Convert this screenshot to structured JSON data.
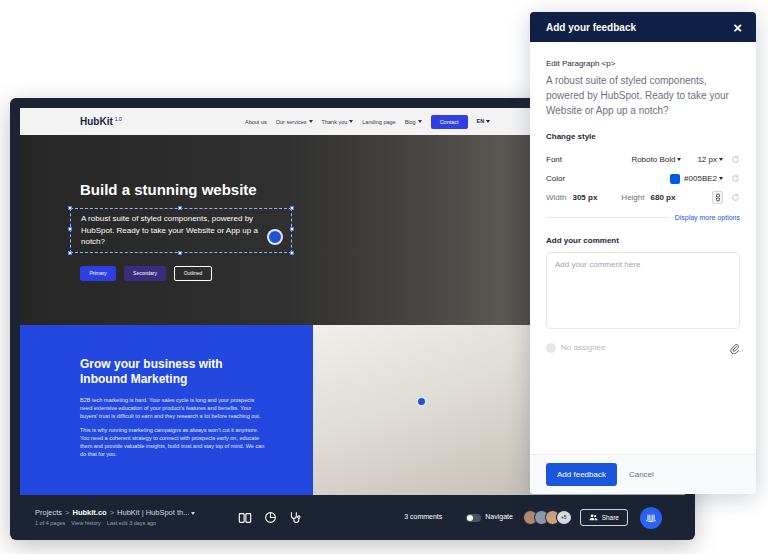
{
  "website": {
    "logo": "HubKit",
    "logo_version": "1.0",
    "nav": [
      {
        "label": "About us",
        "has_menu": false
      },
      {
        "label": "Our services",
        "has_menu": true
      },
      {
        "label": "Thank you",
        "has_menu": true
      },
      {
        "label": "Landing page",
        "has_menu": false
      },
      {
        "label": "Blog",
        "has_menu": true
      }
    ],
    "contact": "Contact",
    "language": {
      "label": "EN",
      "has_menu": true
    },
    "hero": {
      "title": "Build a stunning website",
      "text": "A robust suite of styled components, powered by HubSpot. Ready to take your Website or App up a notch?",
      "selected": true,
      "buttons": [
        {
          "label": "Primary",
          "kind": "primary"
        },
        {
          "label": "Secondary",
          "kind": "secondary"
        },
        {
          "label": "Outlined",
          "kind": "outlined"
        }
      ]
    },
    "section": {
      "title": "Grow your business with Inbound Marketing",
      "paragraphs": [
        "B2B tech marketing is hard. Your sales cycle is long and your prospects need extensive education of your product's features and benefits. Your buyers' trust is difficult to earn and they research a lot before reaching out.",
        "This is why running marketing campaigns as always won't cut it anymore. You need a coherent strategy to connect with prospects early on, educate them and provide valuable insights, build trust and stay top of mind. We can do that for you."
      ]
    }
  },
  "toolbar": {
    "breadcrumb": [
      {
        "label": "Projects",
        "bold": false,
        "has_menu": false
      },
      {
        "label": "Hubkit.co",
        "bold": true,
        "has_menu": false
      },
      {
        "label": "HubKit | HubSpot th...",
        "bold": false,
        "has_menu": true
      }
    ],
    "breadcrumb_separator": ">",
    "pages": "1 of 4 pages",
    "history": "View history",
    "last_edit": "Last edit 3 days ago",
    "comments": "3 comments",
    "navigate": {
      "label": "Navigate",
      "on": false
    },
    "avatars": [
      {
        "color": "#b08a6e"
      },
      {
        "color": "#8a9aa8"
      },
      {
        "color": "#c9a27e"
      }
    ],
    "avatars_more": "+5",
    "share": "Share"
  },
  "panel": {
    "title": "Add your feedback",
    "close": "×",
    "element_label": "Edit Paragraph <p>",
    "element_text": "A robust suite of styled components, powered by HubSpot. Ready to take your Website or App up a notch?",
    "style_heading": "Change style",
    "font": {
      "label": "Font",
      "family": "Roboto Bold",
      "size": "12 px"
    },
    "color": {
      "label": "Color",
      "value": "#005BE2",
      "color": "#005BE2"
    },
    "dimensions": {
      "width_label": "Width",
      "width": "305 px",
      "height_label": "Height",
      "height": "680 px",
      "linked": true
    },
    "more_options": "Display more options",
    "comment_heading": "Add your comment",
    "comment_placeholder": "Add your comment here",
    "assignee": {
      "label": "No assignee",
      "disabled": true
    },
    "submit": "Add feedback",
    "cancel": "Cancel"
  }
}
